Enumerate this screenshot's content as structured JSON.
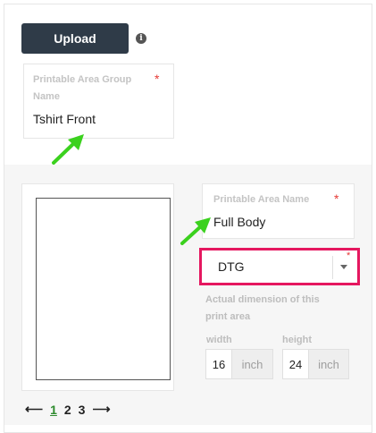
{
  "upload_button": {
    "label": "Upload"
  },
  "info_icon": {
    "glyph": "i",
    "icon": "info-icon"
  },
  "group_card": {
    "label": "Printable Area Group Name",
    "required_mark": "*",
    "value": "Tshirt Front"
  },
  "area_card": {
    "label": "Printable Area Name",
    "required_mark": "*",
    "value": "Full Body"
  },
  "print_method": {
    "selected": "DTG",
    "required_mark": "*",
    "highlight_color": "#e5175f"
  },
  "dimension": {
    "caption": "Actual dimension of this print area",
    "width_label": "width",
    "width_value": "16",
    "width_unit": "inch",
    "height_label": "height",
    "height_value": "24",
    "height_unit": "inch"
  },
  "pagination": {
    "prev": "⟵",
    "pages": [
      "1",
      "2",
      "3"
    ],
    "active_page": "1",
    "next": "⟶"
  },
  "colors": {
    "button_bg": "#2f3b48",
    "annotation_arrow": "#3bd11e",
    "required": "#e53935"
  }
}
